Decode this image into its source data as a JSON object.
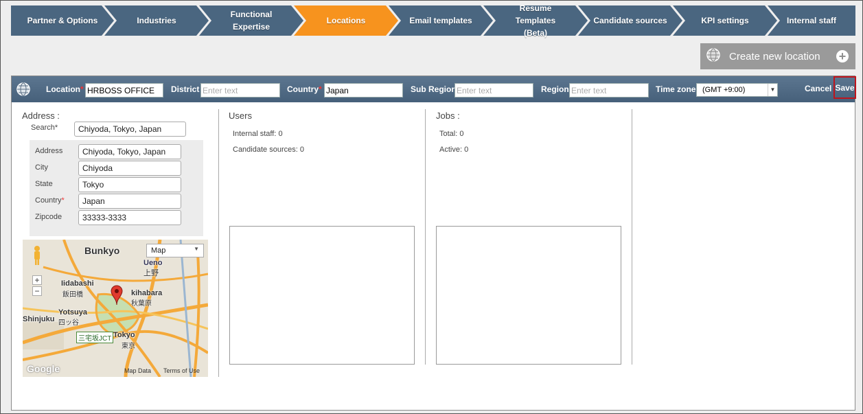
{
  "tabs": [
    {
      "label": "Partner & Options",
      "active": false
    },
    {
      "label": "Industries",
      "active": false
    },
    {
      "label": "Functional Expertise",
      "active": false
    },
    {
      "label": "Locations",
      "active": true
    },
    {
      "label": "Email templates",
      "active": false
    },
    {
      "label": "Resume Templates (Beta)",
      "active": false
    },
    {
      "label": "Candidate sources",
      "active": false
    },
    {
      "label": "KPI settings",
      "active": false
    },
    {
      "label": "Internal staff",
      "active": false
    }
  ],
  "create_button": {
    "label": "Create new location",
    "icon": "globe-icon",
    "plus_icon": "plus-circle-icon"
  },
  "toolbar": {
    "location_label": "Location",
    "location_value": "HRBOSS OFFICE",
    "district_label": "District",
    "district_placeholder": "Enter text",
    "country_label": "Country",
    "country_value": "Japan",
    "subregion_label": "Sub Region",
    "subregion_placeholder": "Enter text",
    "region_label": "Region",
    "region_placeholder": "Enter text",
    "timezone_label": "Time zone",
    "timezone_value": "(GMT +9:00)",
    "cancel_label": "Cancel",
    "save_label": "Save",
    "required_mark": "*"
  },
  "address": {
    "title": "Address :",
    "search_label": "Search*",
    "search_value": "Chiyoda, Tokyo, Japan",
    "address_label": "Address",
    "address_value": "Chiyoda, Tokyo, Japan",
    "city_label": "City",
    "city_value": "Chiyoda",
    "state_label": "State",
    "state_value": "Tokyo",
    "country_label": "Country",
    "country_value": "Japan",
    "zipcode_label": "Zipcode",
    "zipcode_value": "33333-3333"
  },
  "map": {
    "type_value": "Map",
    "zoom_in": "+",
    "zoom_out": "−",
    "map_data": "Map Data",
    "terms": "Terms of Use",
    "google": "Google",
    "labels": {
      "bunkyo": "Bunkyo",
      "iidabashi": "Iidabashi",
      "iidabashi_jp": "飯田橋",
      "akihabara": "kihabara",
      "akihabara_jp": "秋葉原",
      "yotsuya": "Yotsuya",
      "yotsuya_jp": "四ッ谷",
      "shinjuku": "Shinjuku",
      "tokyo": "Tokyo",
      "tokyo_jp": "東京",
      "ueno": "Ueno",
      "ueno_jp": "上野",
      "jct": "三宅坂JCT"
    }
  },
  "users": {
    "title": "Users",
    "internal_staff": "Internal staff: 0",
    "candidate_sources": "Candidate sources: 0"
  },
  "jobs": {
    "title": "Jobs :",
    "total": "Total: 0",
    "active": "Active: 0"
  },
  "colors": {
    "tab_bg": "#4a6680",
    "tab_active": "#f7931e",
    "toolbar_bg": "#4e6883",
    "save_border": "#c0141c"
  }
}
